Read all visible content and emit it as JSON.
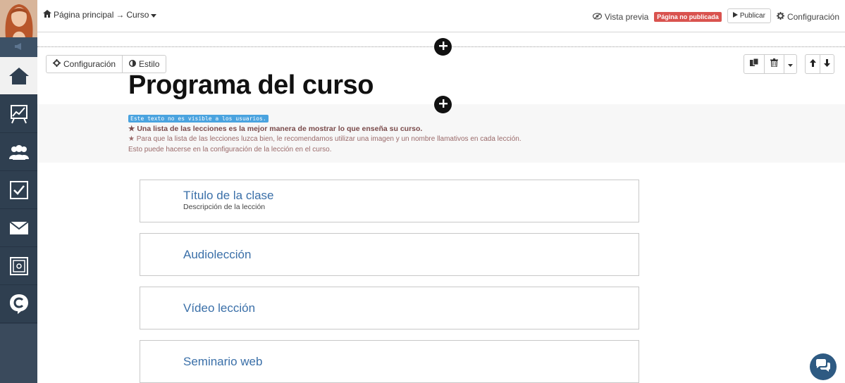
{
  "breadcrumb": {
    "home": "Página principal",
    "arrow": "→",
    "current": "Curso"
  },
  "topbar": {
    "preview_label": "Vista previa",
    "unpublished_badge": "Página no publicada",
    "publish_label": "Publicar",
    "settings_label": "Configuración"
  },
  "toolbar": {
    "settings_label": "Configuración",
    "style_label": "Estilo"
  },
  "page_title": "Programa del curso",
  "info": {
    "hidden_note": "Este texto no es visible a los usuarios.",
    "tip1": "★ Una lista de las lecciones es la mejor manera de mostrar lo que enseña su curso.",
    "tip2": "★ Para que la lista de las lecciones luzca bien, le recomendamos utilizar una imagen y un nombre llamativos en cada lección.",
    "tip3": "Esto puede hacerse en la configuración de la lección en el curso."
  },
  "lessons": [
    {
      "title": "Título de la clase",
      "description": "Descripción de la lección"
    },
    {
      "title": "Audiolección"
    },
    {
      "title": "Vídeo lección"
    },
    {
      "title": "Seminario web"
    }
  ],
  "sidebar": {
    "items": [
      "home-icon",
      "chart-icon",
      "users-icon",
      "checkbox-icon",
      "mail-icon",
      "safe-icon",
      "c-logo-icon"
    ]
  },
  "colors": {
    "sidebar": "#2f3f50",
    "badge": "#d9534f",
    "link": "#3a6fa8",
    "note": "#4aa3df"
  }
}
